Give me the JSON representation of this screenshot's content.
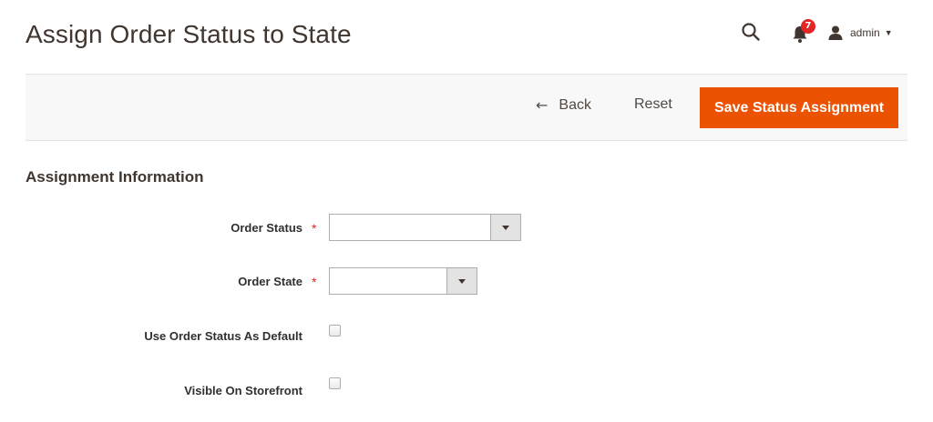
{
  "header": {
    "title": "Assign Order Status to State",
    "notification_count": "7",
    "user_name": "admin"
  },
  "actions": {
    "back_label": "Back",
    "reset_label": "Reset",
    "save_label": "Save Status Assignment"
  },
  "section": {
    "title": "Assignment Information"
  },
  "form": {
    "order_status": {
      "label": "Order Status",
      "required": true,
      "value": ""
    },
    "order_state": {
      "label": "Order State",
      "required": true,
      "value": ""
    },
    "use_default": {
      "label": "Use Order Status As Default",
      "checked": false
    },
    "visible_storefront": {
      "label": "Visible On Storefront",
      "checked": false
    }
  },
  "colors": {
    "accent": "#eb5202",
    "badge": "#e22626",
    "required": "#e22626"
  }
}
